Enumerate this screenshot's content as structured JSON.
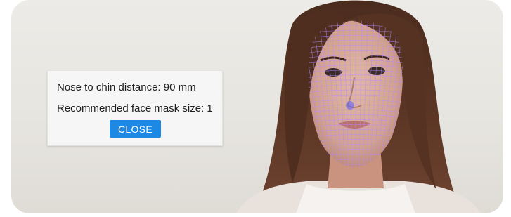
{
  "dialog": {
    "nose_to_chin": "Nose to chin distance: 90 mm",
    "mask_size": "Recommended face mask size: 1",
    "close_label": "CLOSE"
  },
  "colors": {
    "accent": "#1e88e5",
    "mesh": "#b28cff",
    "background": "#ecebe7"
  }
}
